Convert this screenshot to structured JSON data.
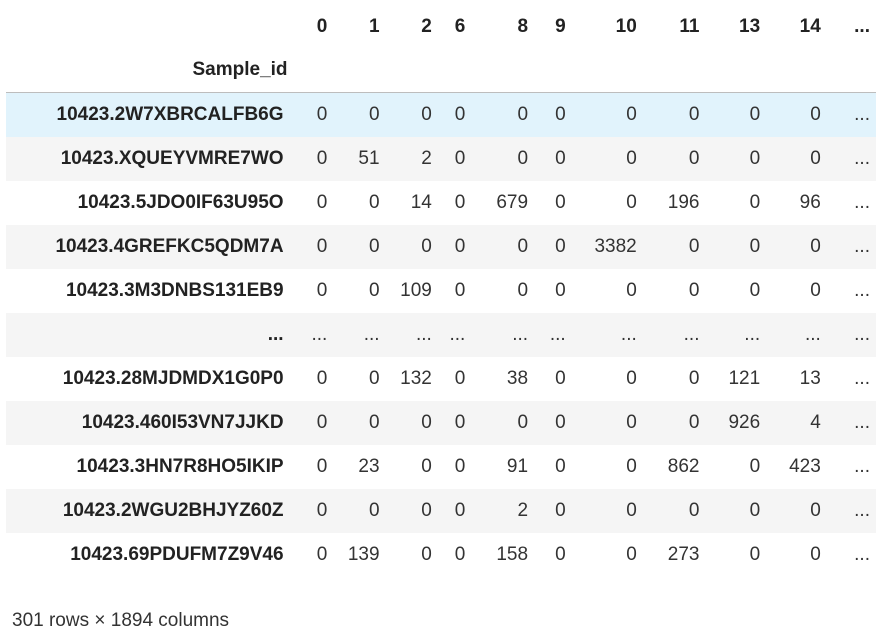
{
  "table": {
    "index_name": "Sample_id",
    "columns": [
      "0",
      "1",
      "2",
      "6",
      "8",
      "9",
      "10",
      "11",
      "13",
      "14",
      "..."
    ],
    "rows": [
      {
        "id": "10423.2W7XBRCALFB6G",
        "values": [
          "0",
          "0",
          "0",
          "0",
          "0",
          "0",
          "0",
          "0",
          "0",
          "0",
          "..."
        ],
        "highlighted": true
      },
      {
        "id": "10423.XQUEYVMRE7WO",
        "values": [
          "0",
          "51",
          "2",
          "0",
          "0",
          "0",
          "0",
          "0",
          "0",
          "0",
          "..."
        ]
      },
      {
        "id": "10423.5JDO0IF63U95O",
        "values": [
          "0",
          "0",
          "14",
          "0",
          "679",
          "0",
          "0",
          "196",
          "0",
          "96",
          "..."
        ]
      },
      {
        "id": "10423.4GREFKC5QDM7A",
        "values": [
          "0",
          "0",
          "0",
          "0",
          "0",
          "0",
          "3382",
          "0",
          "0",
          "0",
          "..."
        ]
      },
      {
        "id": "10423.3M3DNBS131EB9",
        "values": [
          "0",
          "0",
          "109",
          "0",
          "0",
          "0",
          "0",
          "0",
          "0",
          "0",
          "..."
        ]
      },
      {
        "id": "...",
        "values": [
          "...",
          "...",
          "...",
          "...",
          "...",
          "...",
          "...",
          "...",
          "...",
          "...",
          "..."
        ]
      },
      {
        "id": "10423.28MJDMDX1G0P0",
        "values": [
          "0",
          "0",
          "132",
          "0",
          "38",
          "0",
          "0",
          "0",
          "121",
          "13",
          "..."
        ]
      },
      {
        "id": "10423.460I53VN7JJKD",
        "values": [
          "0",
          "0",
          "0",
          "0",
          "0",
          "0",
          "0",
          "0",
          "926",
          "4",
          "..."
        ]
      },
      {
        "id": "10423.3HN7R8HO5IKIP",
        "values": [
          "0",
          "23",
          "0",
          "0",
          "91",
          "0",
          "0",
          "862",
          "0",
          "423",
          "..."
        ]
      },
      {
        "id": "10423.2WGU2BHJYZ60Z",
        "values": [
          "0",
          "0",
          "0",
          "0",
          "2",
          "0",
          "0",
          "0",
          "0",
          "0",
          "..."
        ]
      },
      {
        "id": "10423.69PDUFM7Z9V46",
        "values": [
          "0",
          "139",
          "0",
          "0",
          "158",
          "0",
          "0",
          "273",
          "0",
          "0",
          "..."
        ]
      }
    ],
    "shape_text": "301 rows × 1894 columns"
  }
}
